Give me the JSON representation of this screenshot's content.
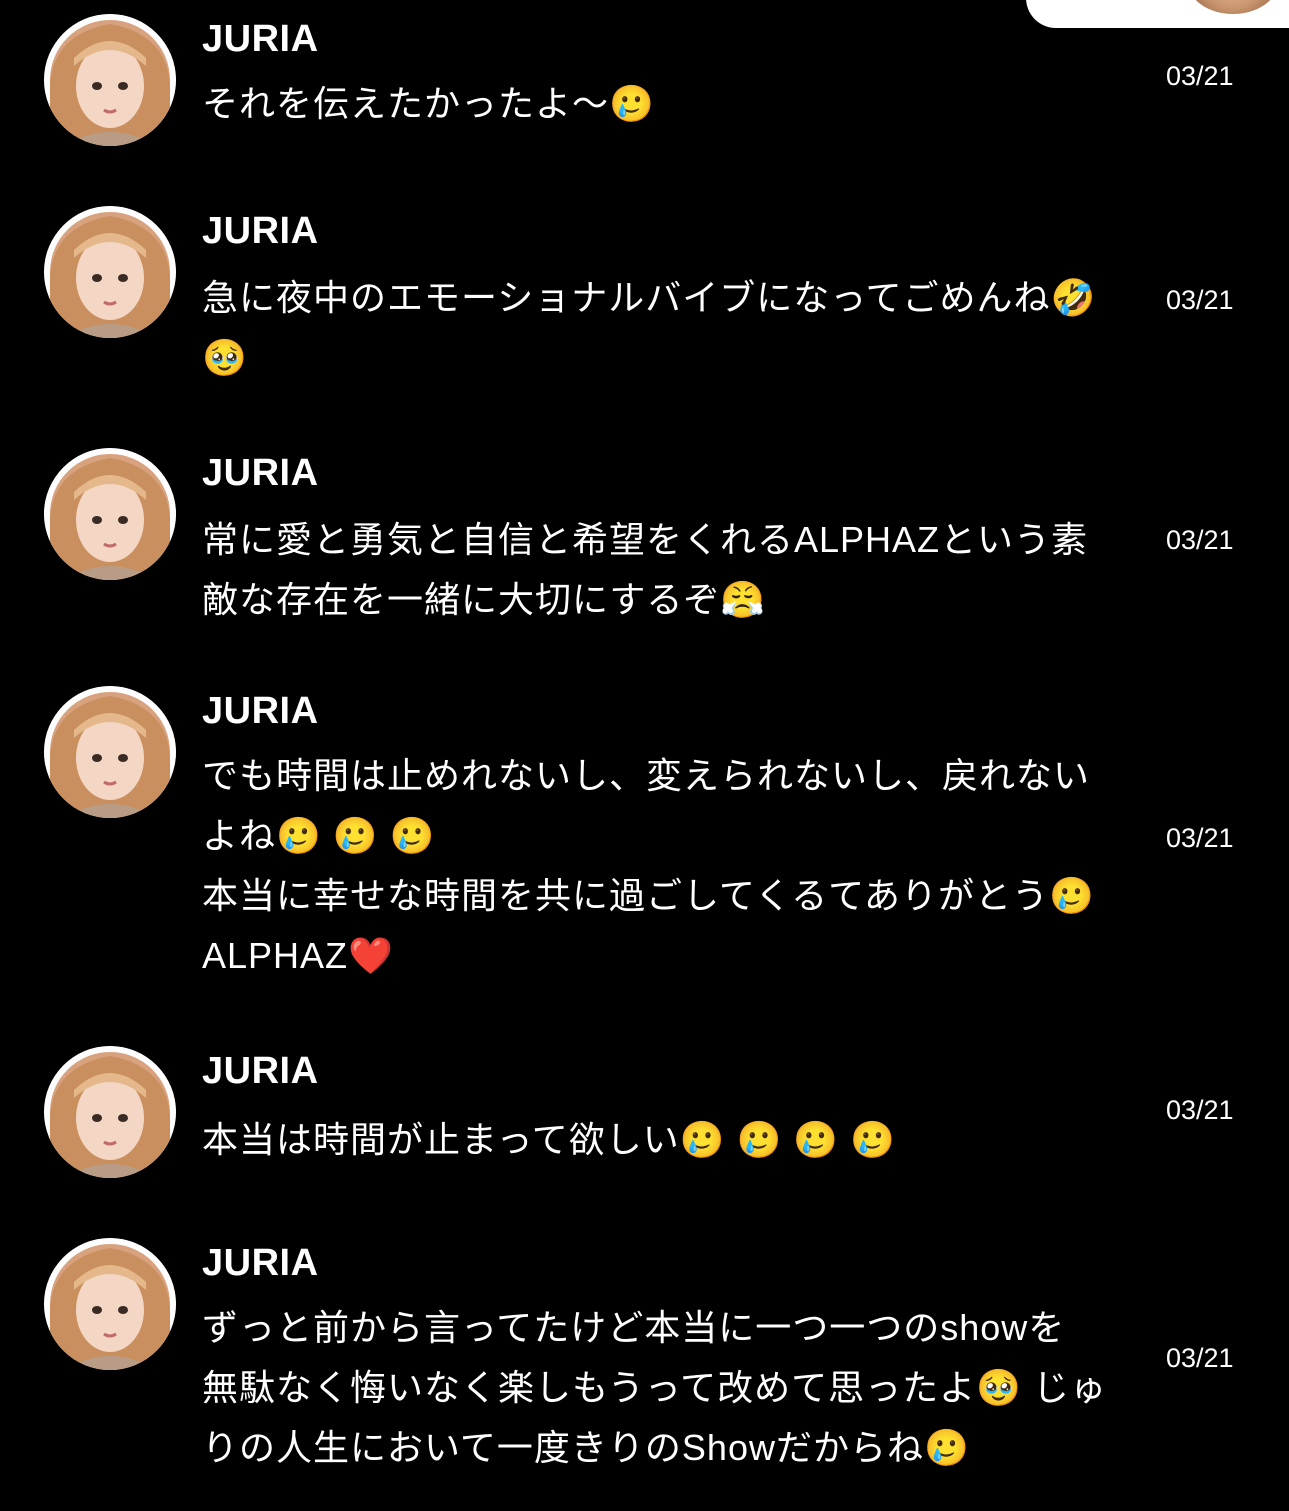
{
  "colors": {
    "background": "#000000",
    "text": "#ffffff",
    "avatar_ring": "#fdfdfd"
  },
  "messages": [
    {
      "sender": "JURIA",
      "text": "それを伝えたかったよ〜🥲",
      "date": "03/21"
    },
    {
      "sender": "JURIA",
      "text": "急に夜中のエモーショナルバイブになってごめんね🤣\n🥹",
      "date": "03/21"
    },
    {
      "sender": "JURIA",
      "text": "常に愛と勇気と自信と希望をくれるALPHAZという素\n敵な存在を一緒に大切にするぞ😤",
      "date": "03/21"
    },
    {
      "sender": "JURIA",
      "text": "でも時間は止めれないし、変えられないし、戻れない\nよね🥲 🥲 🥲\n本当に幸せな時間を共に過ごしてくるてありがとう🥲\nALPHAZ❤️",
      "date": "03/21"
    },
    {
      "sender": "JURIA",
      "text": "本当は時間が止まって欲しい🥲 🥲 🥲 🥲",
      "date": "03/21"
    },
    {
      "sender": "JURIA",
      "text": "ずっと前から言ってたけど本当に一つ一つのshowを\n無駄なく悔いなく楽しもうって改めて思ったよ🥹 じゅ\nりの人生において一度きりのShowだからね🥲",
      "date": "03/21"
    }
  ]
}
